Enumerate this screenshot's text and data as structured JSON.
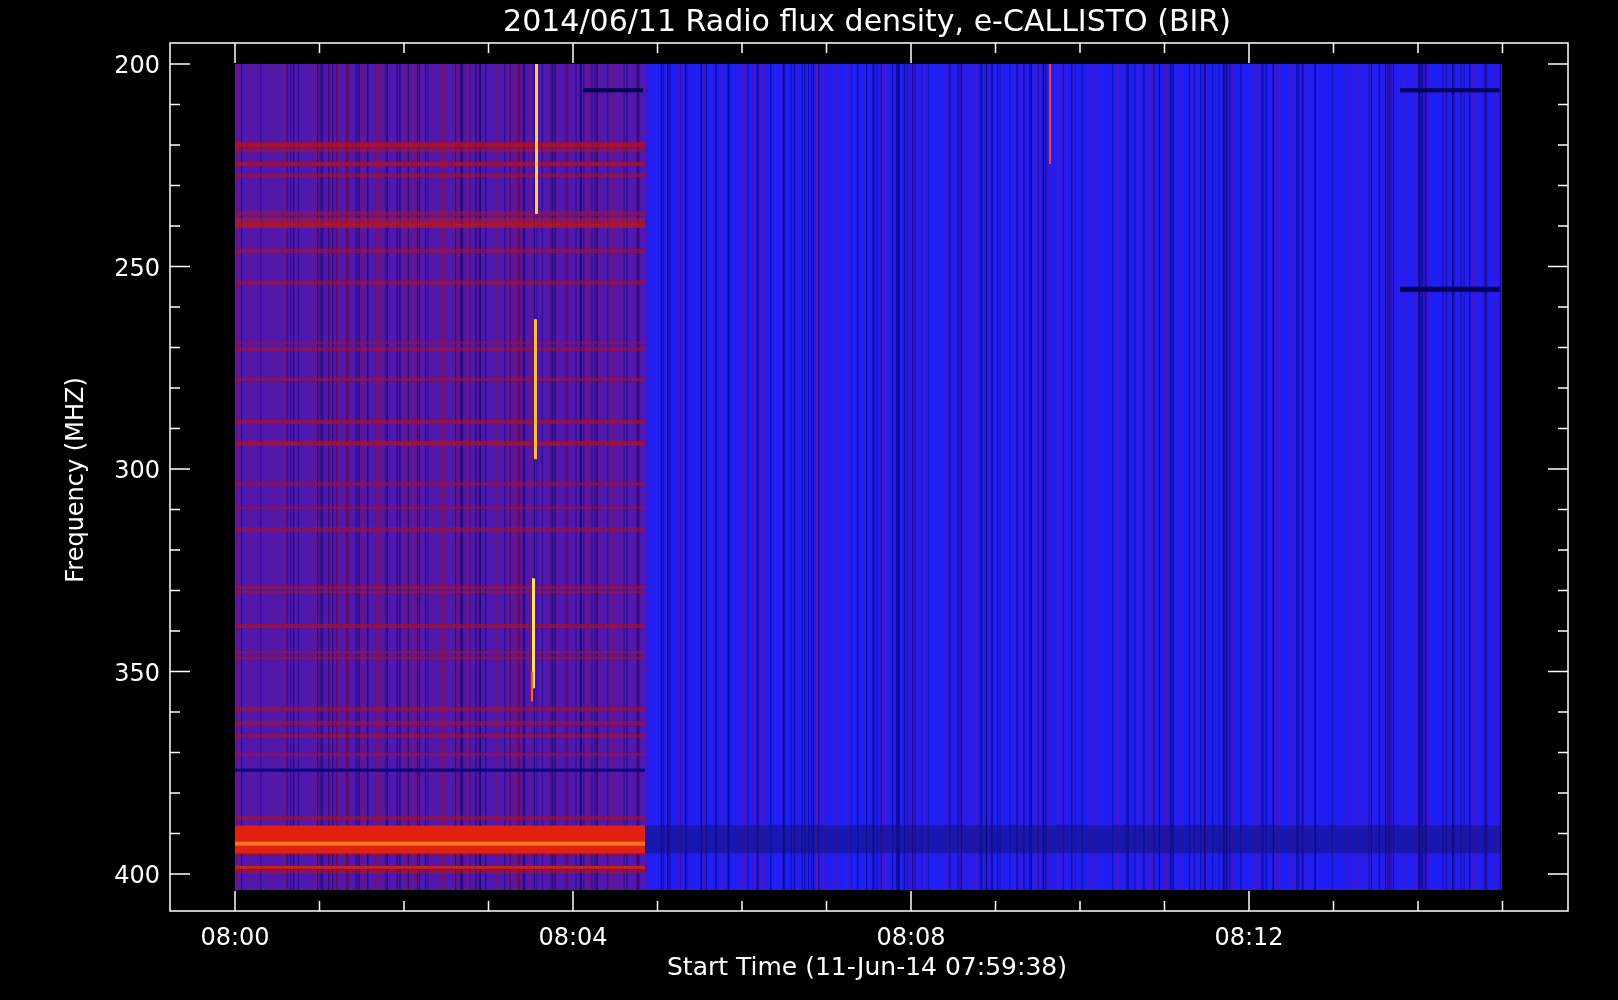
{
  "title": "2014/06/11  Radio flux density, e-CALLISTO (BIR)",
  "y_axis": {
    "label": "Frequency (MHZ)",
    "ticks": [
      "200",
      "250",
      "300",
      "350",
      "400"
    ]
  },
  "x_axis": {
    "label": "Start Time (11-Jun-14 07:59:38)",
    "ticks": [
      "08:00",
      "08:04",
      "08:08",
      "08:12"
    ]
  }
}
